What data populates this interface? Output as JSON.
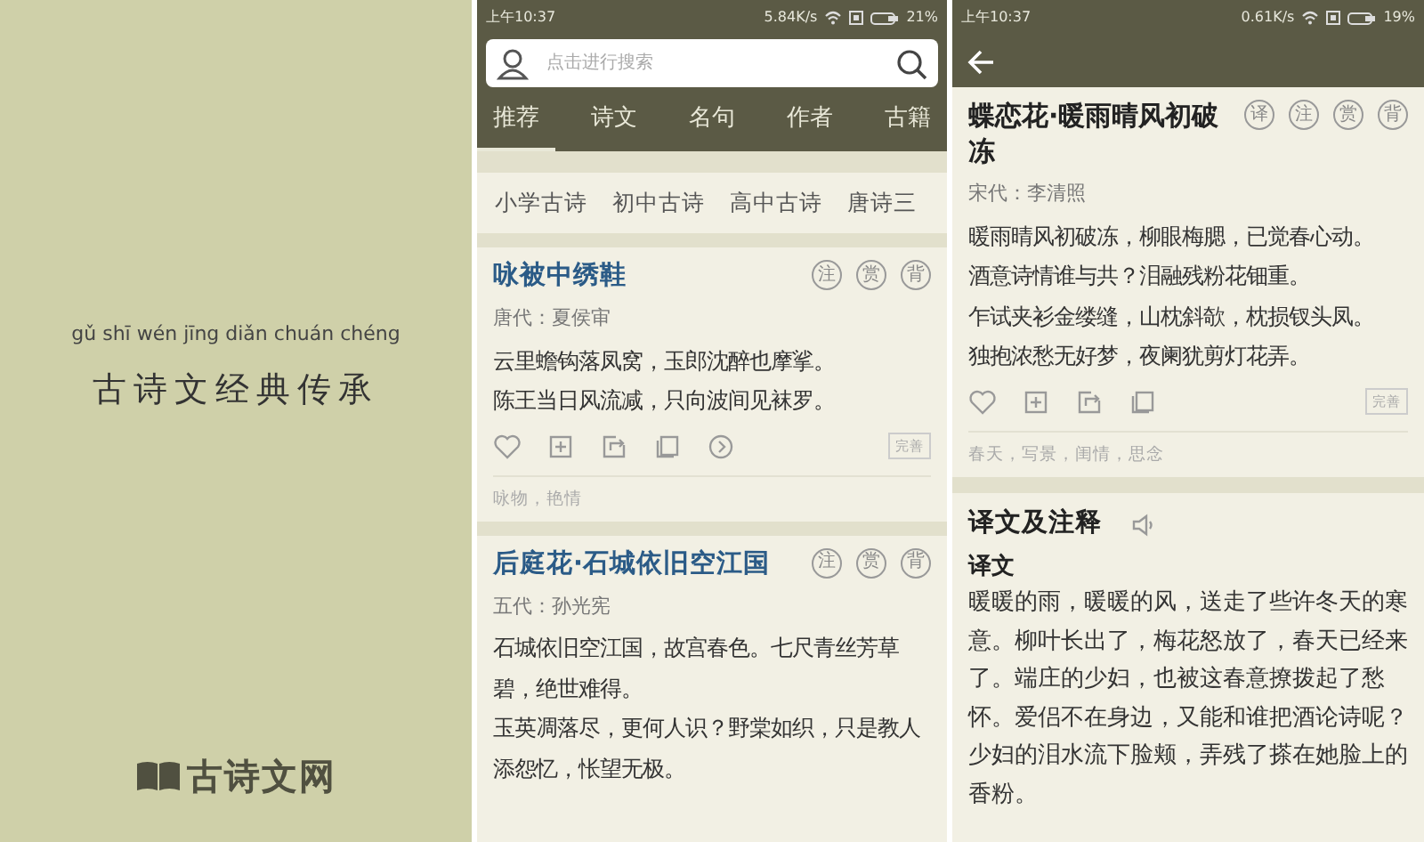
{
  "splash": {
    "pinyin": "gǔ shī wén jīng diǎn chuán chéng",
    "slogan": "古诗文经典传承",
    "logo_text": "古诗文网"
  },
  "list_screen": {
    "status_bar": {
      "time": "上午10:37",
      "speed": "5.84K/s",
      "battery": "21%"
    },
    "search": {
      "placeholder": "点击进行搜索"
    },
    "tabs": [
      {
        "label": "推荐",
        "selected": true
      },
      {
        "label": "诗文",
        "selected": false
      },
      {
        "label": "名句",
        "selected": false
      },
      {
        "label": "作者",
        "selected": false
      },
      {
        "label": "古籍",
        "selected": false
      }
    ],
    "categories": [
      "小学古诗",
      "初中古诗",
      "高中古诗",
      "唐诗三"
    ],
    "poems": [
      {
        "title": "咏被中绣鞋",
        "badges": [
          "注",
          "赏",
          "背"
        ],
        "author": "唐代：夏侯审",
        "lines": [
          "云里蟾钩落凤窝，玉郎沈醉也摩挲。",
          "陈王当日风流减，只向波间见袜罗。"
        ],
        "edit_label": "完善",
        "tags": "咏物，艳情"
      },
      {
        "title": "后庭花·石城依旧空江国",
        "badges": [
          "注",
          "赏",
          "背"
        ],
        "author": "五代：孙光宪",
        "lines": [
          "石城依旧空江国，故宫春色。七尺青丝芳草碧，绝世难得。",
          "玉英凋落尽，更何人识？野棠如织，只是教人添怨忆，怅望无极。"
        ]
      }
    ]
  },
  "detail_screen": {
    "status_bar": {
      "time": "上午10:37",
      "speed": "0.61K/s",
      "battery": "19%"
    },
    "poem": {
      "title": "蝶恋花·暖雨晴风初破冻",
      "badges": [
        "译",
        "注",
        "赏",
        "背"
      ],
      "author": "宋代：李清照",
      "lines": [
        "暖雨晴风初破冻，柳眼梅腮，已觉春心动。",
        "酒意诗情谁与共？泪融残粉花钿重。",
        "乍试夹衫金缕缝，山枕斜欹，枕损钗头凤。",
        "独抱浓愁无好梦，夜阑犹剪灯花弄。"
      ],
      "edit_label": "完善",
      "tags": "春天，写景，闺情，思念"
    },
    "section": {
      "title": "译文及注释",
      "subtitle": "译文",
      "text": "暖暖的雨，暖暖的风，送走了些许冬天的寒意。柳叶长出了，梅花怒放了，春天已经来了。端庄的少妇，也被这春意撩拨起了愁怀。爱侣不在身边，又能和谁把酒论诗呢？少妇的泪水流下脸颊，弄残了搽在她脸上的香粉。"
    }
  }
}
